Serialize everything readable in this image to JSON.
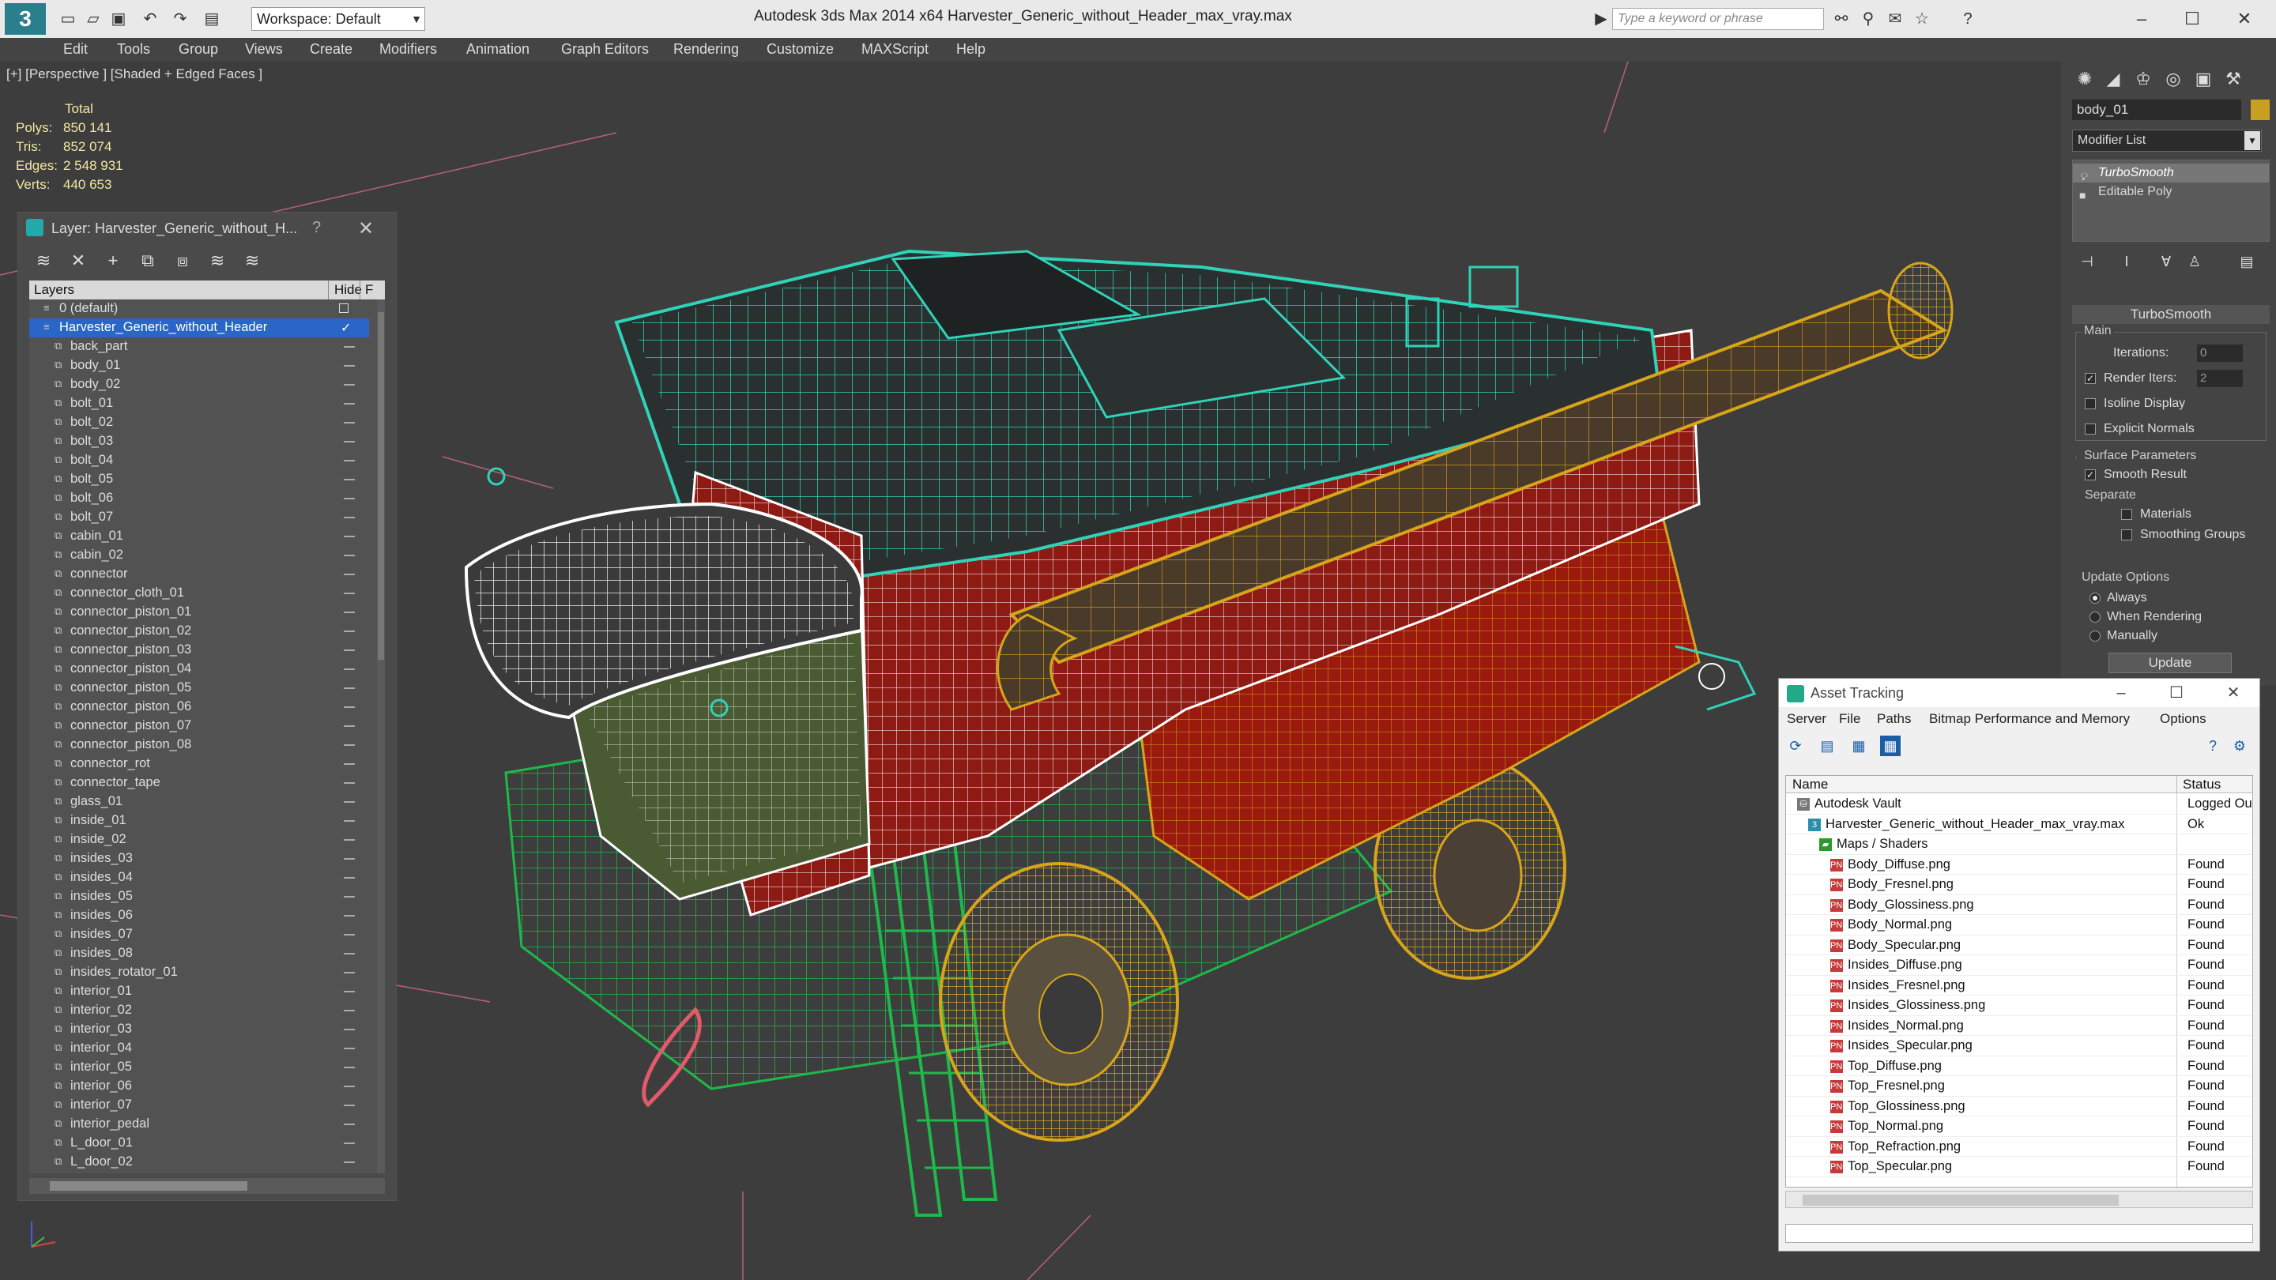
{
  "titlebar": {
    "logo": "3",
    "workspace": "Workspace: Default",
    "title": "Autodesk 3ds Max  2014 x64      Harvester_Generic_without_Header_max_vray.max",
    "search_placeholder": "Type a keyword or phrase"
  },
  "menubar": [
    "Edit",
    "Tools",
    "Group",
    "Views",
    "Create",
    "Modifiers",
    "Animation",
    "Graph Editors",
    "Rendering",
    "Customize",
    "MAXScript",
    "Help"
  ],
  "viewport": {
    "label": "[+] [Perspective ] [Shaded + Edged Faces ]",
    "stats": {
      "header": "Total",
      "rows": [
        {
          "label": "Polys:",
          "value": "850 141"
        },
        {
          "label": "Tris:",
          "value": "852 074"
        },
        {
          "label": "Edges:",
          "value": "2 548 931"
        },
        {
          "label": "Verts:",
          "value": "440 653"
        }
      ]
    }
  },
  "layer_panel": {
    "title": "Layer: Harvester_Generic_without_H...",
    "help": "?",
    "close": "✕",
    "columns": {
      "layers": "Layers",
      "hide": "Hide",
      "freeze": "F"
    },
    "rows": [
      {
        "name": "0 (default)",
        "level": 0
      },
      {
        "name": "Harvester_Generic_without_Header",
        "level": 0,
        "selected": true
      },
      {
        "name": "back_part",
        "level": 1
      },
      {
        "name": "body_01",
        "level": 1
      },
      {
        "name": "body_02",
        "level": 1
      },
      {
        "name": "bolt_01",
        "level": 1
      },
      {
        "name": "bolt_02",
        "level": 1
      },
      {
        "name": "bolt_03",
        "level": 1
      },
      {
        "name": "bolt_04",
        "level": 1
      },
      {
        "name": "bolt_05",
        "level": 1
      },
      {
        "name": "bolt_06",
        "level": 1
      },
      {
        "name": "bolt_07",
        "level": 1
      },
      {
        "name": "cabin_01",
        "level": 1
      },
      {
        "name": "cabin_02",
        "level": 1
      },
      {
        "name": "connector",
        "level": 1
      },
      {
        "name": "connector_cloth_01",
        "level": 1
      },
      {
        "name": "connector_piston_01",
        "level": 1
      },
      {
        "name": "connector_piston_02",
        "level": 1
      },
      {
        "name": "connector_piston_03",
        "level": 1
      },
      {
        "name": "connector_piston_04",
        "level": 1
      },
      {
        "name": "connector_piston_05",
        "level": 1
      },
      {
        "name": "connector_piston_06",
        "level": 1
      },
      {
        "name": "connector_piston_07",
        "level": 1
      },
      {
        "name": "connector_piston_08",
        "level": 1
      },
      {
        "name": "connector_rot",
        "level": 1
      },
      {
        "name": "connector_tape",
        "level": 1
      },
      {
        "name": "glass_01",
        "level": 1
      },
      {
        "name": "inside_01",
        "level": 1
      },
      {
        "name": "inside_02",
        "level": 1
      },
      {
        "name": "insides_03",
        "level": 1
      },
      {
        "name": "insides_04",
        "level": 1
      },
      {
        "name": "insides_05",
        "level": 1
      },
      {
        "name": "insides_06",
        "level": 1
      },
      {
        "name": "insides_07",
        "level": 1
      },
      {
        "name": "insides_08",
        "level": 1
      },
      {
        "name": "insides_rotator_01",
        "level": 1
      },
      {
        "name": "interior_01",
        "level": 1
      },
      {
        "name": "interior_02",
        "level": 1
      },
      {
        "name": "interior_03",
        "level": 1
      },
      {
        "name": "interior_04",
        "level": 1
      },
      {
        "name": "interior_05",
        "level": 1
      },
      {
        "name": "interior_06",
        "level": 1
      },
      {
        "name": "interior_07",
        "level": 1
      },
      {
        "name": "interior_pedal",
        "level": 1
      },
      {
        "name": "L_door_01",
        "level": 1
      },
      {
        "name": "L_door_02",
        "level": 1
      }
    ]
  },
  "command_panel": {
    "object_name": "body_01",
    "modifier_list": "Modifier List",
    "stack": [
      "TurboSmooth",
      "Editable Poly"
    ],
    "turbosmooth": {
      "title": "TurboSmooth",
      "main": "Main",
      "iterations_label": "Iterations:",
      "iterations_value": "0",
      "render_iters_label": "Render Iters:",
      "render_iters_value": "2",
      "isoline": "Isoline Display",
      "explicit": "Explicit Normals",
      "surface": "Surface Parameters",
      "smooth_result": "Smooth Result",
      "separate": "Separate",
      "materials": "Materials",
      "smoothing_groups": "Smoothing Groups",
      "update_options": "Update Options",
      "always": "Always",
      "when_rendering": "When Rendering",
      "manually": "Manually",
      "update": "Update"
    }
  },
  "asset_tracking": {
    "title": "Asset Tracking",
    "menu": [
      "Server",
      "File",
      "Paths",
      "Bitmap Performance and Memory",
      "Options"
    ],
    "columns": {
      "name": "Name",
      "status": "Status"
    },
    "rows": [
      {
        "name": "Autodesk Vault",
        "status": "Logged Ou",
        "indent": 0,
        "icon": "vault"
      },
      {
        "name": "Harvester_Generic_without_Header_max_vray.max",
        "status": "Ok",
        "indent": 1,
        "icon": "max"
      },
      {
        "name": "Maps / Shaders",
        "status": "",
        "indent": 2,
        "icon": "folder"
      },
      {
        "name": "Body_Diffuse.png",
        "status": "Found",
        "indent": 3,
        "icon": "png"
      },
      {
        "name": "Body_Fresnel.png",
        "status": "Found",
        "indent": 3,
        "icon": "png"
      },
      {
        "name": "Body_Glossiness.png",
        "status": "Found",
        "indent": 3,
        "icon": "png"
      },
      {
        "name": "Body_Normal.png",
        "status": "Found",
        "indent": 3,
        "icon": "png"
      },
      {
        "name": "Body_Specular.png",
        "status": "Found",
        "indent": 3,
        "icon": "png"
      },
      {
        "name": "Insides_Diffuse.png",
        "status": "Found",
        "indent": 3,
        "icon": "png"
      },
      {
        "name": "Insides_Fresnel.png",
        "status": "Found",
        "indent": 3,
        "icon": "png"
      },
      {
        "name": "Insides_Glossiness.png",
        "status": "Found",
        "indent": 3,
        "icon": "png"
      },
      {
        "name": "Insides_Normal.png",
        "status": "Found",
        "indent": 3,
        "icon": "png"
      },
      {
        "name": "Insides_Specular.png",
        "status": "Found",
        "indent": 3,
        "icon": "png"
      },
      {
        "name": "Top_Diffuse.png",
        "status": "Found",
        "indent": 3,
        "icon": "png"
      },
      {
        "name": "Top_Fresnel.png",
        "status": "Found",
        "indent": 3,
        "icon": "png"
      },
      {
        "name": "Top_Glossiness.png",
        "status": "Found",
        "indent": 3,
        "icon": "png"
      },
      {
        "name": "Top_Normal.png",
        "status": "Found",
        "indent": 3,
        "icon": "png"
      },
      {
        "name": "Top_Refraction.png",
        "status": "Found",
        "indent": 3,
        "icon": "png"
      },
      {
        "name": "Top_Specular.png",
        "status": "Found",
        "indent": 3,
        "icon": "png"
      }
    ]
  },
  "colors": {
    "selection": "#2a66c8",
    "wire_cyan": "#2fd3b8",
    "wire_green": "#1fb84a",
    "wire_yellow": "#d8a51a",
    "body_red": "#9a1a12",
    "background": "#3d3d3d"
  }
}
